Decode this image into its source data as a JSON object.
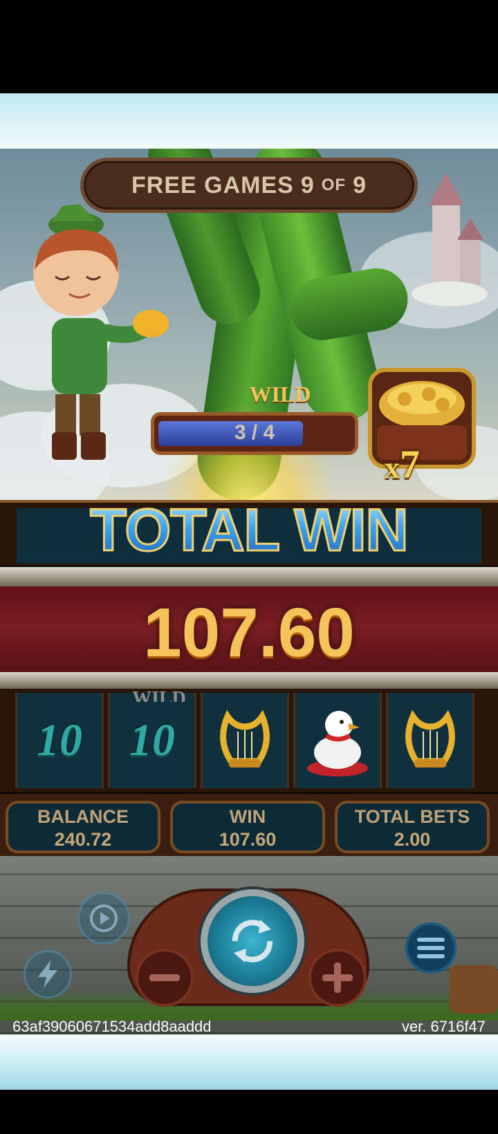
{
  "header": {
    "free_games_label": "FREE GAMES",
    "free_games_current": "9",
    "free_games_of": "OF",
    "free_games_total": "9"
  },
  "wild_meter": {
    "label": "WILD",
    "progress_text": "3 / 4",
    "progress_fraction": 0.75
  },
  "multiplier": {
    "prefix": "x",
    "value": "7"
  },
  "total_win": {
    "title": "TOTAL WIN",
    "amount": "107.60"
  },
  "reels": {
    "partial_label": "WILD",
    "symbols": [
      {
        "name": "ten",
        "text": "10"
      },
      {
        "name": "ten",
        "text": "10"
      },
      {
        "name": "harp",
        "text": ""
      },
      {
        "name": "goose-egg",
        "text": ""
      },
      {
        "name": "harp",
        "text": ""
      }
    ]
  },
  "info": {
    "balance_label": "BALANCE",
    "balance_value": "240.72",
    "win_label": "WIN",
    "win_value": "107.60",
    "total_bets_label": "TOTAL BETS",
    "total_bets_value": "2.00"
  },
  "footer": {
    "session_id": "63af39060671534add8aaddd",
    "version": "ver. 6716f47"
  },
  "icons": {
    "spin": "spin-arrows-icon",
    "minus": "minus-icon",
    "plus": "plus-icon",
    "auto": "autoplay-icon",
    "turbo": "lightning-icon",
    "menu": "hamburger-menu-icon"
  },
  "colors": {
    "title_blue": "#2e86d6",
    "gold": "#f6c25a",
    "banner_red": "#7a1e22",
    "panel_teal": "#0c2b36"
  }
}
